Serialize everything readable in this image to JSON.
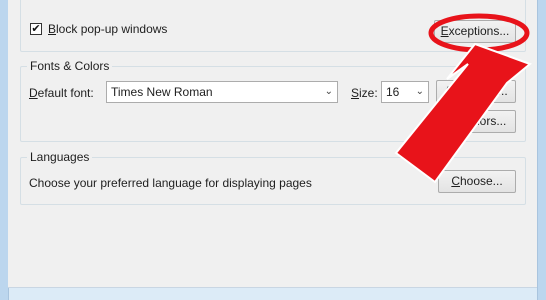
{
  "popups": {
    "block_label": "Block pop-up windows",
    "checked": true,
    "check_glyph": "✔",
    "exceptions_label": "Exceptions..."
  },
  "fonts": {
    "group_label": "Fonts & Colors",
    "default_font_label": "Default font:",
    "default_font_value": "Times New Roman",
    "size_label": "Size:",
    "size_value": "16",
    "advanced_label": "Advanced...",
    "colors_label": "Colors..."
  },
  "languages": {
    "group_label": "Languages",
    "description": "Choose your preferred language for displaying pages",
    "choose_label": "Choose..."
  },
  "icons": {
    "dropdown": "chevron-down-icon",
    "dropdown_glyph": "⌄"
  },
  "annotation": {
    "color": "#e8131a"
  }
}
